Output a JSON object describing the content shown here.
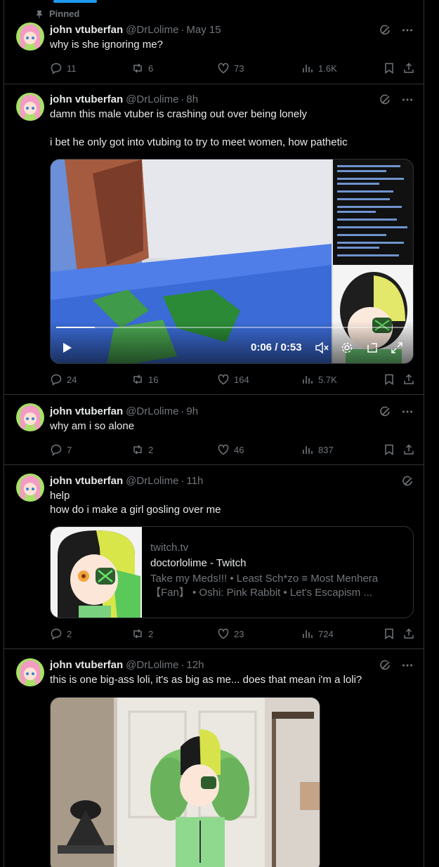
{
  "colors": {
    "accent": "#1d9bf0",
    "muted": "#71767b",
    "border": "#2f3336",
    "background": "#000000"
  },
  "pinned_label": "Pinned",
  "author": {
    "name": "john vtuberfan",
    "handle": "@DrLolime"
  },
  "posts": [
    {
      "time": "May 15",
      "text": "why is she ignoring me?",
      "stats": {
        "replies": "11",
        "reposts": "6",
        "likes": "73",
        "views": "1.6K"
      }
    },
    {
      "time": "8h",
      "text": "damn this male vtuber is crashing out over being lonely\n\ni bet he only got into vtubing to try to meet women, how pathetic",
      "video": {
        "time_label": "0:06 / 0:53",
        "progress": 0.11
      },
      "stats": {
        "replies": "24",
        "reposts": "16",
        "likes": "164",
        "views": "5.7K"
      }
    },
    {
      "time": "9h",
      "text": "why am i so alone",
      "stats": {
        "replies": "7",
        "reposts": "2",
        "likes": "46",
        "views": "837"
      }
    },
    {
      "time": "11h",
      "text": "help\nhow do i make a girl gosling over me",
      "card": {
        "domain": "twitch.tv",
        "title": "doctorlolime - Twitch",
        "description": "Take my Meds!!!  • Least Sch*zo ≡ Most Menhera 【Fan】  •  Oshi: Pink Rabbit  • Let's Escapism ..."
      },
      "stats": {
        "replies": "2",
        "reposts": "2",
        "likes": "23",
        "views": "724"
      }
    },
    {
      "time": "12h",
      "text": "this is one big-ass loli, it's as big as me... does that mean i'm a loli?"
    }
  ]
}
